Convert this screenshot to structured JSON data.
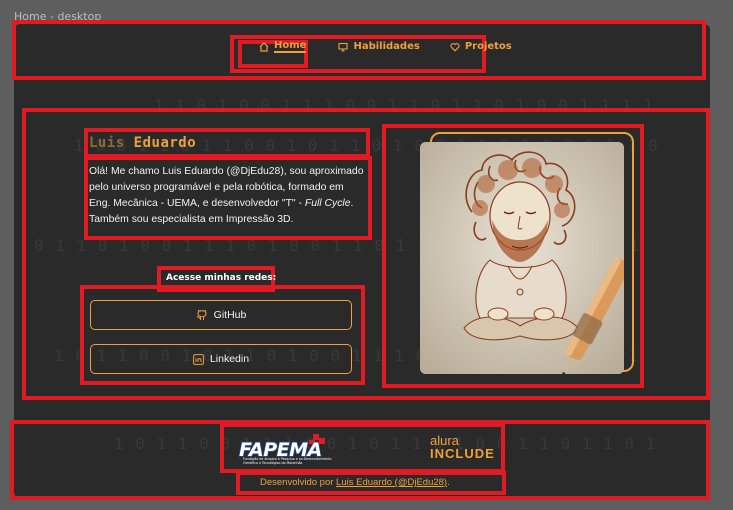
{
  "frame_label": "Home - desktop",
  "nav": {
    "items": [
      {
        "label": "Home",
        "icon": "home-icon",
        "active": true
      },
      {
        "label": "Habilidades",
        "icon": "monitor-icon",
        "active": false
      },
      {
        "label": "Projetos",
        "icon": "heart-icon",
        "active": false
      }
    ]
  },
  "profile": {
    "first_name": "Luis",
    "last_name": "Eduardo",
    "bio_part1": "Olá! Me chamo Luis Eduardo (@DjEdu28), sou aproximado pelo universo programável e pela robótica, formado em Eng. Mecânica - UEMA, e desenvolvedor \"T\" - ",
    "bio_em": "Full Cycle",
    "bio_part2": ". Também sou especialista em Impressão 3D."
  },
  "social": {
    "title": "Acesse minhas redes:",
    "github_label": "GitHub",
    "linkedin_label": "Linkedin"
  },
  "footer": {
    "fapema_logo_text": "FAPEMA",
    "fapema_subtitle": "Fundação de Amparo à Pesquisa e ao Desenvolvimento Científico e Tecnológico do Maranhão",
    "alura_line1": "alura",
    "alura_line2": "INCLUDE",
    "credit_prefix": "Desenvolvido por ",
    "credit_link": "Luis Eduardo (@DjEdu28)",
    "credit_suffix": "."
  },
  "colors": {
    "accent": "#f0a03a",
    "background": "#2b2a2b",
    "annotation": "#e01b24"
  }
}
